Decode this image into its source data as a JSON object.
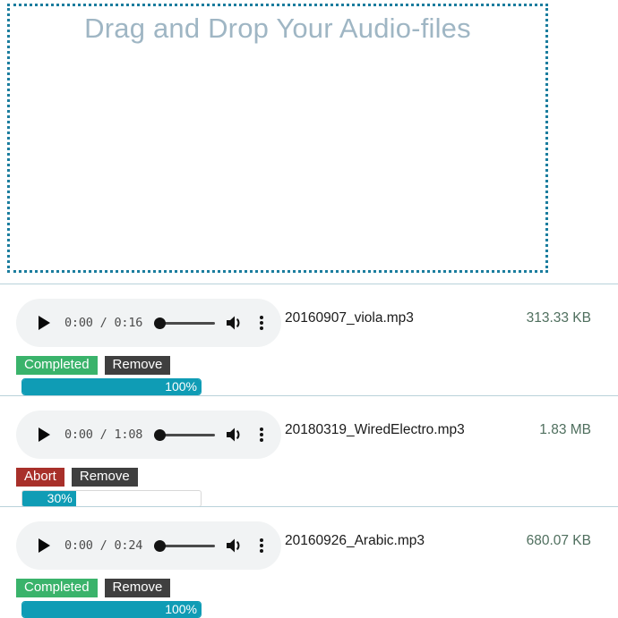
{
  "dropzone": {
    "title": "Drag and Drop Your Audio-files",
    "border_color": "#1b7d9e",
    "title_color": "#9fb6c4"
  },
  "colors": {
    "completed": "#3ab36b",
    "abort": "#a8302a",
    "remove": "#3f3f3f",
    "progress": "#0f9cb5",
    "divider": "#b9d2da",
    "player_bg": "#f1f3f4",
    "file_size_text": "#4f6f5e"
  },
  "files": [
    {
      "name": "20160907_viola.mp3",
      "size": "313.33 KB",
      "player": {
        "time": "0:00 / 0:16",
        "current_time": "0:00",
        "duration": "0:16",
        "seek_position_percent": 0,
        "play_icon": "play-icon",
        "volume_icon": "volume-icon",
        "menu_icon": "kebab-menu-icon"
      },
      "status_label": "Completed",
      "status_kind": "completed",
      "remove_label": "Remove",
      "progress_percent": 100,
      "progress_label": "100%"
    },
    {
      "name": "20180319_WiredElectro.mp3",
      "size": "1.83 MB",
      "player": {
        "time": "0:00 / 1:08",
        "current_time": "0:00",
        "duration": "1:08",
        "seek_position_percent": 0,
        "play_icon": "play-icon",
        "volume_icon": "volume-icon",
        "menu_icon": "kebab-menu-icon"
      },
      "status_label": "Abort",
      "status_kind": "abort",
      "remove_label": "Remove",
      "progress_percent": 30,
      "progress_label": "30%"
    },
    {
      "name": "20160926_Arabic.mp3",
      "size": "680.07 KB",
      "player": {
        "time": "0:00 / 0:24",
        "current_time": "0:00",
        "duration": "0:24",
        "seek_position_percent": 0,
        "play_icon": "play-icon",
        "volume_icon": "volume-icon",
        "menu_icon": "kebab-menu-icon"
      },
      "status_label": "Completed",
      "status_kind": "completed",
      "remove_label": "Remove",
      "progress_percent": 100,
      "progress_label": "100%"
    }
  ]
}
